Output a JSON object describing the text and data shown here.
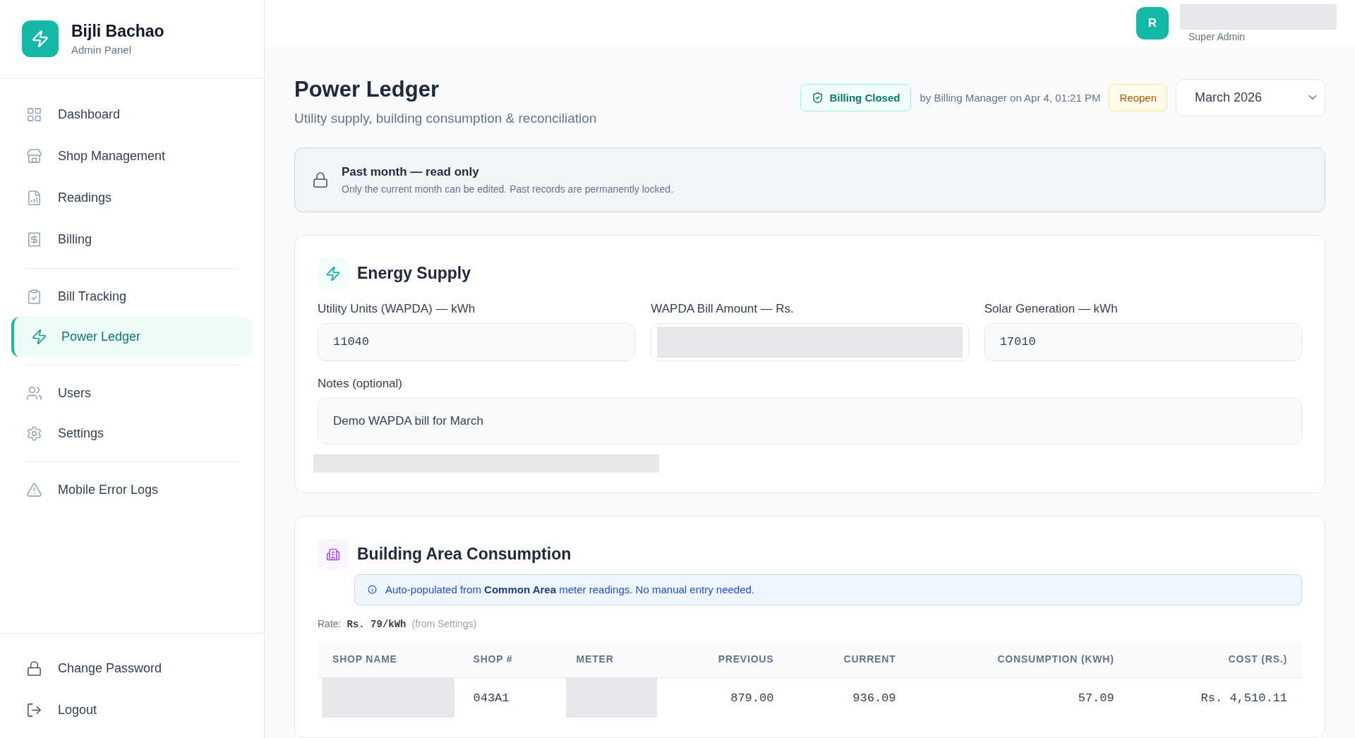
{
  "brand": {
    "name": "Bijli Bachao",
    "subtitle": "Admin Panel"
  },
  "nav_groups": [
    [
      {
        "label": "Dashboard",
        "selected": false
      },
      {
        "label": "Shop Management",
        "selected": false
      },
      {
        "label": "Readings",
        "selected": false
      },
      {
        "label": "Billing",
        "selected": false
      }
    ],
    [
      {
        "label": "Bill Tracking",
        "selected": false
      },
      {
        "label": "Power Ledger",
        "selected": true
      }
    ],
    [
      {
        "label": "Users",
        "selected": false
      },
      {
        "label": "Settings",
        "selected": false
      }
    ],
    [
      {
        "label": "Mobile Error Logs",
        "selected": false
      }
    ]
  ],
  "sidebar_footer": [
    {
      "label": "Change Password"
    },
    {
      "label": "Logout"
    }
  ],
  "user": {
    "initial": "R",
    "role": "Super Admin"
  },
  "page": {
    "title": "Power Ledger",
    "subtitle": "Utility supply, building consumption & reconciliation"
  },
  "billing_status": {
    "badge": "Billing Closed",
    "meta": "by Billing Manager on Apr 4, 01:21 PM",
    "action": "Reopen",
    "month": "March 2026"
  },
  "notice": {
    "title": "Past month — read only",
    "text": "Only the current month can be edited. Past records are permanently locked."
  },
  "energy_supply": {
    "title": "Energy Supply",
    "fields": [
      {
        "label": "Utility Units (WAPDA) — kWh",
        "kind": "text",
        "value": "11040"
      },
      {
        "label": "WAPDA Bill Amount — Rs.",
        "kind": "redacted"
      },
      {
        "label": "Solar Generation — kWh",
        "kind": "text",
        "value": "17010"
      }
    ],
    "notes": {
      "label": "Notes (optional)",
      "value": "Demo WAPDA bill for March"
    }
  },
  "building_consumption": {
    "title": "Building Area Consumption",
    "info": "Auto-populated from **Common Area** meter readings. No manual entry needed.",
    "rate_label": "Rate:",
    "rate": "Rs. 79/kWh",
    "rate_note": "(from Settings)",
    "table": {
      "columns": [
        {
          "label": "SHOP NAME",
          "kind": "text"
        },
        {
          "label": "SHOP #",
          "kind": "text"
        },
        {
          "label": "METER",
          "kind": "text"
        },
        {
          "label": "PREVIOUS",
          "kind": "number"
        },
        {
          "label": "CURRENT",
          "kind": "number"
        },
        {
          "label": "CONSUMPTION (KWH)",
          "kind": "number"
        },
        {
          "label": "COST (RS.)",
          "kind": "number"
        }
      ],
      "rows": [
        [
          {
            "kind": "redacted"
          },
          {
            "kind": "text",
            "text": "043A1"
          },
          {
            "kind": "redacted"
          },
          {
            "kind": "text",
            "text": "879.00"
          },
          {
            "kind": "text",
            "text": "936.09"
          },
          {
            "kind": "text",
            "text": "57.09"
          },
          {
            "kind": "text",
            "text": "Rs. 4,510.11"
          }
        ]
      ]
    }
  }
}
